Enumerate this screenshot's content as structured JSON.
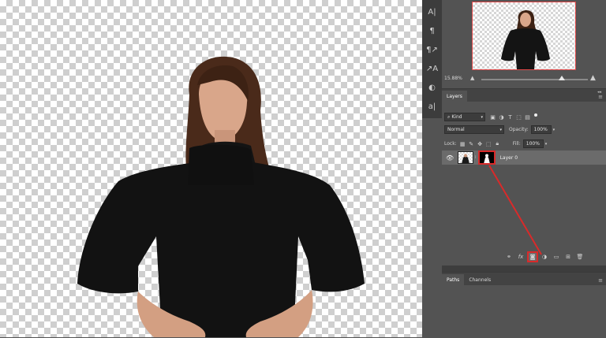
{
  "navigator": {
    "zoom": "15.88%"
  },
  "layers": {
    "tabs": [
      {
        "label": "Layers"
      }
    ],
    "filter": {
      "label": "Kind"
    },
    "blend_mode": "Normal",
    "opacity_label": "Opacity:",
    "opacity_value": "100%",
    "lock_label": "Lock:",
    "fill_label": "Fill:",
    "fill_value": "100%",
    "layer_name": "Layer 0"
  },
  "paths": {
    "tabs": [
      {
        "label": "Paths"
      },
      {
        "label": "Channels"
      }
    ]
  },
  "colors": {
    "highlight": "#d92a2a",
    "panel": "#535353",
    "selected_layer": "#6b6b6b"
  },
  "icons": {
    "toolstrip": [
      "character-icon",
      "paragraph-icon",
      "paragraph-styles-icon",
      "character-styles-icon",
      "adjust-icon",
      "glyphs-icon"
    ],
    "layer_bottom": [
      "link-icon",
      "fx-icon",
      "add-mask-icon",
      "adjustment-icon",
      "group-icon",
      "new-layer-icon",
      "delete-icon"
    ]
  }
}
